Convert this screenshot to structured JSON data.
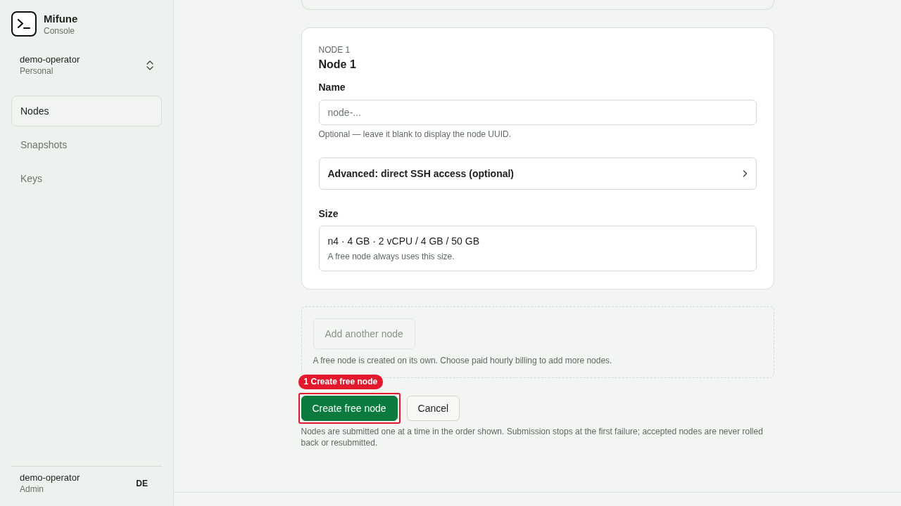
{
  "sidebar": {
    "brand": {
      "name": "Mifune",
      "subtitle": "Console"
    },
    "account": {
      "name": "demo-operator",
      "plan": "Personal"
    },
    "nav": [
      {
        "label": "Nodes",
        "selected": true
      },
      {
        "label": "Snapshots",
        "selected": false
      },
      {
        "label": "Keys",
        "selected": false
      }
    ],
    "user": {
      "name": "demo-operator",
      "role": "Admin",
      "initials": "DE"
    }
  },
  "node_card": {
    "eyebrow": "NODE 1",
    "title": "Node 1",
    "name_field": {
      "label": "Name",
      "placeholder": "node-...",
      "help": "Optional — leave it blank to display the node UUID."
    },
    "advanced": {
      "label": "Advanced: direct SSH access (optional)",
      "expanded": false
    },
    "size": {
      "label": "Size",
      "value": "n4 · 4 GB · 2 vCPU / 4 GB / 50 GB",
      "help": "A free node always uses this size."
    }
  },
  "add_node": {
    "button": {
      "label": "Add another node",
      "disabled": true
    },
    "help": "A free node is created on its own. Choose paid hourly billing to add more nodes."
  },
  "actions": {
    "buttons": [
      {
        "label": "Create free node",
        "kind": "primary",
        "annotation": "1 Create free node"
      },
      {
        "label": "Cancel",
        "kind": "secondary"
      }
    ],
    "note": "Nodes are submitted one at a time in the order shown. Submission stops at the first failure; accepted nodes are never rolled back or resubmitted."
  }
}
